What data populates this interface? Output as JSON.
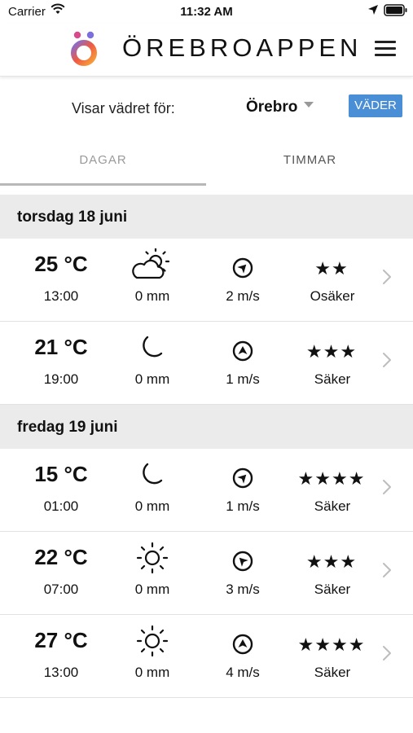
{
  "status_bar": {
    "carrier": "Carrier",
    "time": "11:32 AM"
  },
  "header": {
    "title": "ÖREBROAPPEN",
    "logo_colors": [
      "#f05a43",
      "#f6a63a",
      "#7b6ee0",
      "#d94a8c"
    ]
  },
  "location": {
    "label": "Visar vädret för:",
    "value": "Örebro",
    "button_label": "VÄDER"
  },
  "colors": {
    "accent": "#4a8fd6",
    "section_bg": "#ebebeb"
  },
  "tabs": [
    {
      "label": "DAGAR",
      "active": true
    },
    {
      "label": "TIMMAR",
      "active": false
    }
  ],
  "days": [
    {
      "title": "torsdag 18 juni",
      "rows": [
        {
          "temp": "25 °C",
          "time": "13:00",
          "icon": "partly-cloudy-icon",
          "precip": "0 mm",
          "wind": "2 m/s",
          "wind_dir_deg": 315,
          "stars": "★★",
          "reliability": "Osäker"
        },
        {
          "temp": "21 °C",
          "time": "19:00",
          "icon": "moon-icon",
          "precip": "0 mm",
          "wind": "1 m/s",
          "wind_dir_deg": 270,
          "stars": "★★★",
          "reliability": "Säker"
        }
      ]
    },
    {
      "title": "fredag 19 juni",
      "rows": [
        {
          "temp": "15 °C",
          "time": "01:00",
          "icon": "moon-icon",
          "precip": "0 mm",
          "wind": "1 m/s",
          "wind_dir_deg": 315,
          "stars": "★★★★",
          "reliability": "Säker"
        },
        {
          "temp": "22 °C",
          "time": "07:00",
          "icon": "sun-icon",
          "precip": "0 mm",
          "wind": "3 m/s",
          "wind_dir_deg": 225,
          "stars": "★★★",
          "reliability": "Säker"
        },
        {
          "temp": "27 °C",
          "time": "13:00",
          "icon": "sun-icon",
          "precip": "0 mm",
          "wind": "4 m/s",
          "wind_dir_deg": 270,
          "stars": "★★★★",
          "reliability": "Säker"
        }
      ]
    }
  ]
}
